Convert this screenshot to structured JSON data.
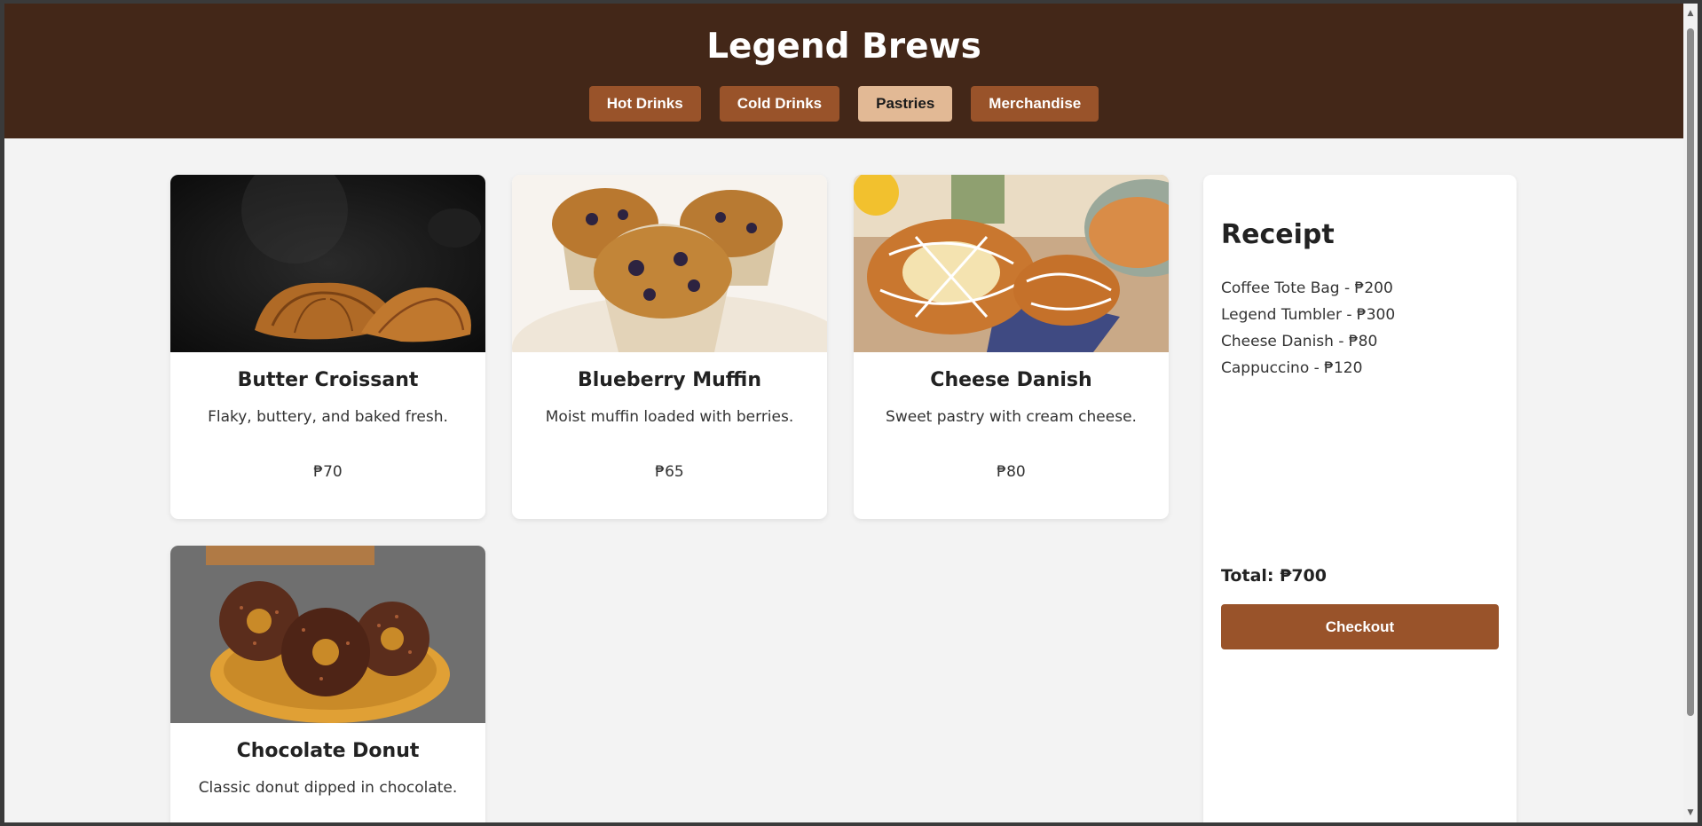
{
  "header": {
    "title": "Legend Brews",
    "tabs": [
      {
        "label": "Hot Drinks",
        "active": false
      },
      {
        "label": "Cold Drinks",
        "active": false
      },
      {
        "label": "Pastries",
        "active": true
      },
      {
        "label": "Merchandise",
        "active": false
      }
    ]
  },
  "products": [
    {
      "name": "Butter Croissant",
      "description": "Flaky, buttery, and baked fresh.",
      "price": "₱70",
      "image_icon": "croissant-photo"
    },
    {
      "name": "Blueberry Muffin",
      "description": "Moist muffin loaded with berries.",
      "price": "₱65",
      "image_icon": "muffin-photo"
    },
    {
      "name": "Cheese Danish",
      "description": "Sweet pastry with cream cheese.",
      "price": "₱80",
      "image_icon": "danish-photo"
    },
    {
      "name": "Chocolate Donut",
      "description": "Classic donut dipped in chocolate.",
      "price": "",
      "image_icon": "donut-photo"
    }
  ],
  "receipt": {
    "title": "Receipt",
    "items": [
      "Coffee Tote Bag - ₱200",
      "Legend Tumbler - ₱300",
      "Cheese Danish - ₱80",
      "Cappuccino - ₱120"
    ],
    "total_label": "Total: ₱700",
    "checkout_label": "Checkout"
  },
  "colors": {
    "header_bg": "#432718",
    "button_bg": "#99532a",
    "active_tab_bg": "#e2b995",
    "page_bg": "#f3f3f3"
  }
}
